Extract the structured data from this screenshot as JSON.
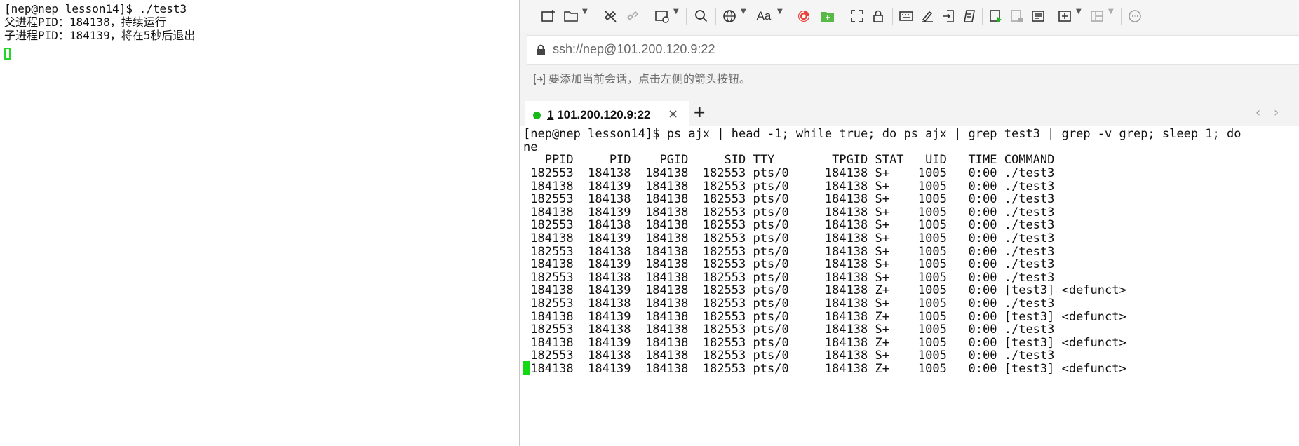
{
  "left_terminal": {
    "lines": [
      "[nep@nep lesson14]$ ./test3",
      "父进程PID：184138，持续运行",
      "子进程PID：184139，将在5秒后退出"
    ]
  },
  "toolbar": {
    "font_button_label": "Aa",
    "icons": [
      "new-session-icon",
      "open-folder-icon",
      "disconnect-icon",
      "reconnect-icon",
      "session-manager-icon",
      "search-icon",
      "globe-icon",
      "font-icon",
      "shell-icon",
      "sftp-icon",
      "fullscreen-icon",
      "lock-icon",
      "keyboard-icon",
      "highlight-icon",
      "transfer-icon",
      "script-icon",
      "log-start-icon",
      "log-stop-icon",
      "notes-icon",
      "new-tab-icon",
      "layout-icon",
      "chat-icon"
    ]
  },
  "address_bar": {
    "url": "ssh://nep@101.200.120.9:22"
  },
  "session_hint": {
    "text": "要添加当前会话，点击左侧的箭头按钮。"
  },
  "tabs": [
    {
      "number": "1",
      "label": " 101.200.120.9:22",
      "status_color": "#17b817"
    }
  ],
  "tab_controls": {
    "close": "×",
    "new": "+",
    "prev": "‹",
    "next": "›"
  },
  "terminal": {
    "lines": [
      "[nep@nep lesson14]$ ps ajx | head -1; while true; do ps ajx | grep test3 | grep -v grep; sleep 1; do",
      "ne",
      "   PPID     PID    PGID     SID TTY        TPGID STAT   UID   TIME COMMAND",
      " 182553  184138  184138  182553 pts/0     184138 S+    1005   0:00 ./test3",
      " 184138  184139  184138  182553 pts/0     184138 S+    1005   0:00 ./test3",
      " 182553  184138  184138  182553 pts/0     184138 S+    1005   0:00 ./test3",
      " 184138  184139  184138  182553 pts/0     184138 S+    1005   0:00 ./test3",
      " 182553  184138  184138  182553 pts/0     184138 S+    1005   0:00 ./test3",
      " 184138  184139  184138  182553 pts/0     184138 S+    1005   0:00 ./test3",
      " 182553  184138  184138  182553 pts/0     184138 S+    1005   0:00 ./test3",
      " 184138  184139  184138  182553 pts/0     184138 S+    1005   0:00 ./test3",
      " 182553  184138  184138  182553 pts/0     184138 S+    1005   0:00 ./test3",
      " 184138  184139  184138  182553 pts/0     184138 Z+    1005   0:00 [test3] <defunct>",
      " 182553  184138  184138  182553 pts/0     184138 S+    1005   0:00 ./test3",
      " 184138  184139  184138  182553 pts/0     184138 Z+    1005   0:00 [test3] <defunct>",
      " 182553  184138  184138  182553 pts/0     184138 S+    1005   0:00 ./test3",
      " 184138  184139  184138  182553 pts/0     184138 Z+    1005   0:00 [test3] <defunct>",
      " 182553  184138  184138  182553 pts/0     184138 S+    1005   0:00 ./test3",
      " 184138  184139  184138  182553 pts/0     184138 Z+    1005   0:00 [test3] <defunct>"
    ]
  },
  "colors": {
    "cursor": "#12d912",
    "connected": "#17b817"
  }
}
